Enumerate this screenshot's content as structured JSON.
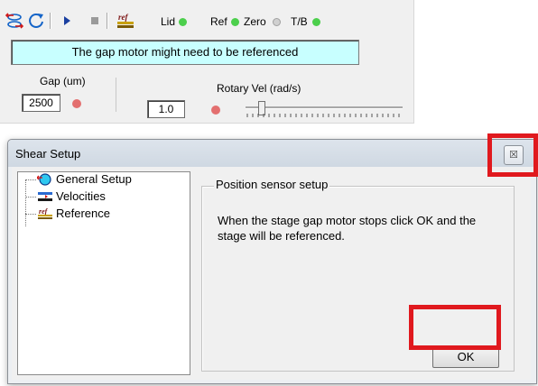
{
  "toolbar": {
    "icons": [
      "shear-setup-icon",
      "refresh-icon",
      "play-icon",
      "stop-icon",
      "reference-icon"
    ],
    "indicators": [
      {
        "label": "Lid",
        "status": "green"
      },
      {
        "label": "Ref",
        "status": "green"
      },
      {
        "label": "Zero",
        "status": "gray"
      },
      {
        "label": "T/B",
        "status": "green"
      }
    ]
  },
  "status_message": "The gap motor might need to be referenced",
  "gap": {
    "label": "Gap (um)",
    "value": "2500"
  },
  "rotary": {
    "label": "Rotary Vel (rad/s)",
    "value": "1.0"
  },
  "dialog": {
    "title": "Shear Setup",
    "close_glyph": "☒",
    "tree": [
      {
        "label": "General Setup",
        "icon": "general-setup-icon"
      },
      {
        "label": "Velocities",
        "icon": "velocities-icon"
      },
      {
        "label": "Reference",
        "icon": "reference-icon"
      }
    ],
    "group_title": "Position sensor setup",
    "message": "When the stage gap motor stops click OK and the stage will be referenced.",
    "ok_label": "OK"
  },
  "colors": {
    "led_green": "#4ccf4c",
    "led_gray": "#d0d0d0",
    "led_red": "#e36f6f",
    "message_bg": "#c8ffff",
    "highlight": "#e0191e"
  }
}
